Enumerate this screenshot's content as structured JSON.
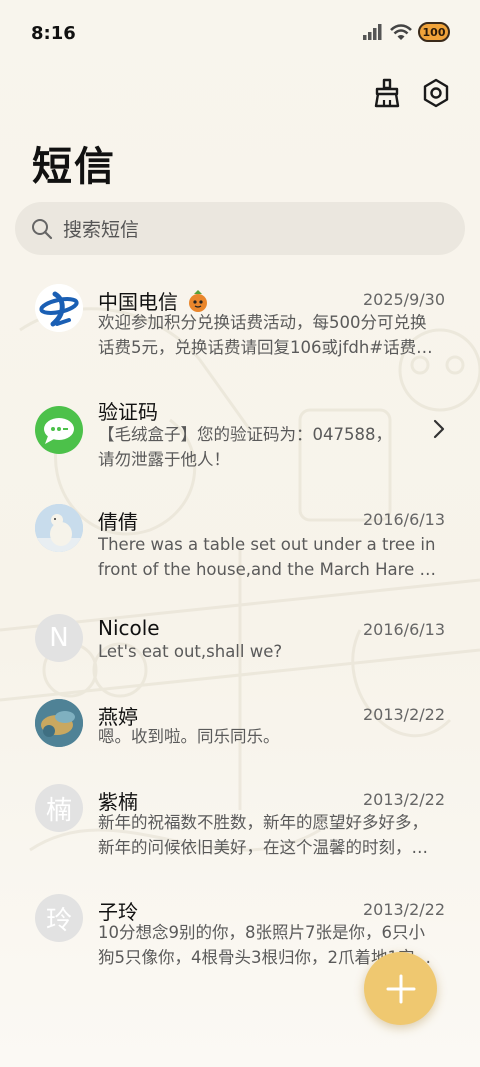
{
  "status": {
    "time": "8:16",
    "battery": "100"
  },
  "header": {
    "title": "短信"
  },
  "search": {
    "placeholder": "搜索短信"
  },
  "messages": [
    {
      "sender": "中国电信",
      "date": "2025/9/30",
      "lines": [
        "欢迎参加积分兑换话费活动，每500分可兑换",
        "话费5元，兑换话费请回复106或jfdh#话费…"
      ]
    },
    {
      "sender": "验证码",
      "date": "",
      "lines": [
        "【毛绒盒子】您的验证码为：047588，",
        "请勿泄露于他人！"
      ]
    },
    {
      "sender": "倩倩",
      "date": "2016/6/13",
      "lines": [
        "There was a table set out under a tree in",
        "front of the house,and the March Hare an…"
      ]
    },
    {
      "sender": "Nicole",
      "date": "2016/6/13",
      "avatar_letter": "N",
      "lines": [
        "Let's eat out,shall we?"
      ]
    },
    {
      "sender": "燕婷",
      "date": "2013/2/22",
      "lines": [
        "嗯。收到啦。同乐同乐。"
      ]
    },
    {
      "sender": "紫楠",
      "date": "2013/2/22",
      "avatar_letter": "楠",
      "lines": [
        "新年的祝福数不胜数，新年的愿望好多好多，",
        "新年的问候依旧美好，在这个温馨的时刻，…"
      ]
    },
    {
      "sender": "子玲",
      "date": "2013/2/22",
      "avatar_letter": "玲",
      "lines": [
        "10分想念9别的你，8张照片7张是你，6只小",
        "狗5只像你，4根骨头3根归你，2爪着地1宝…"
      ]
    }
  ],
  "colors": {
    "fab": "#efc870",
    "telecom_blue": "#1a5fb4",
    "sms_green": "#4cc14a"
  },
  "icons": {
    "clean": "broom-icon",
    "settings": "settings-icon",
    "search": "search-icon",
    "compose": "plus-icon"
  }
}
